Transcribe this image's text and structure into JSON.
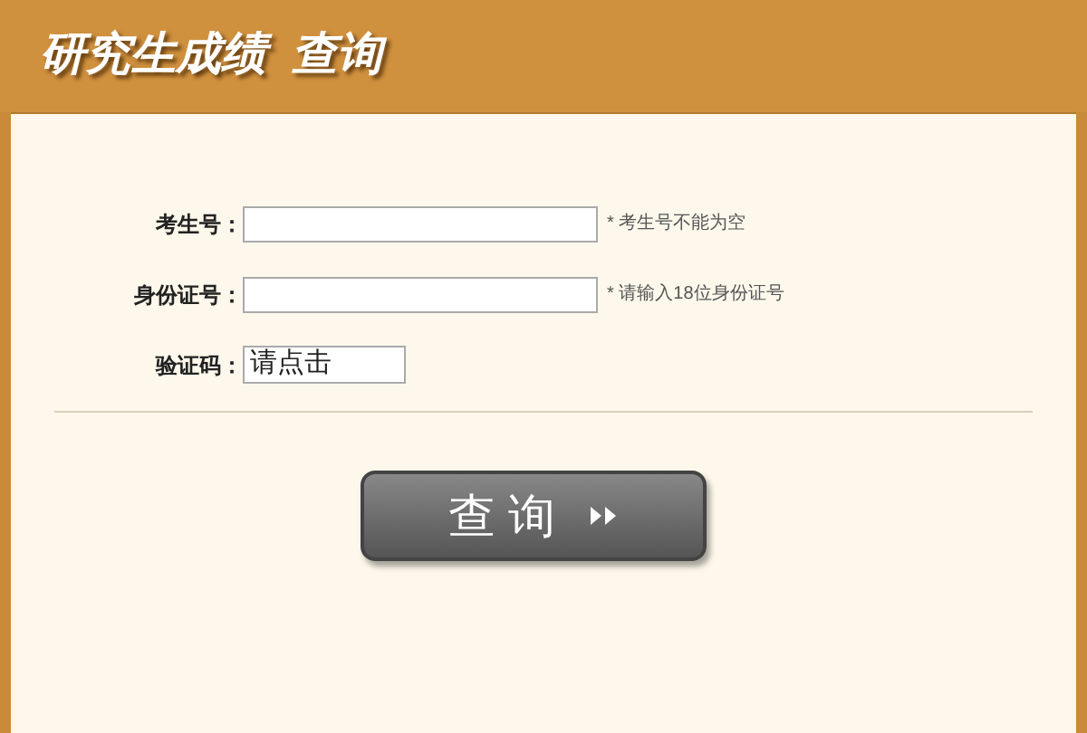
{
  "header": {
    "title": "研究生成绩  查询"
  },
  "fields": [
    {
      "kind": "text",
      "label": "考生号：",
      "hint": "* 考生号不能为空"
    },
    {
      "kind": "text",
      "label": "身份证号：",
      "hint": "* 请输入18位身份证号"
    },
    {
      "kind": "captcha",
      "label": "验证码：",
      "value": "请点击"
    }
  ],
  "submit": {
    "label": "查 询"
  }
}
